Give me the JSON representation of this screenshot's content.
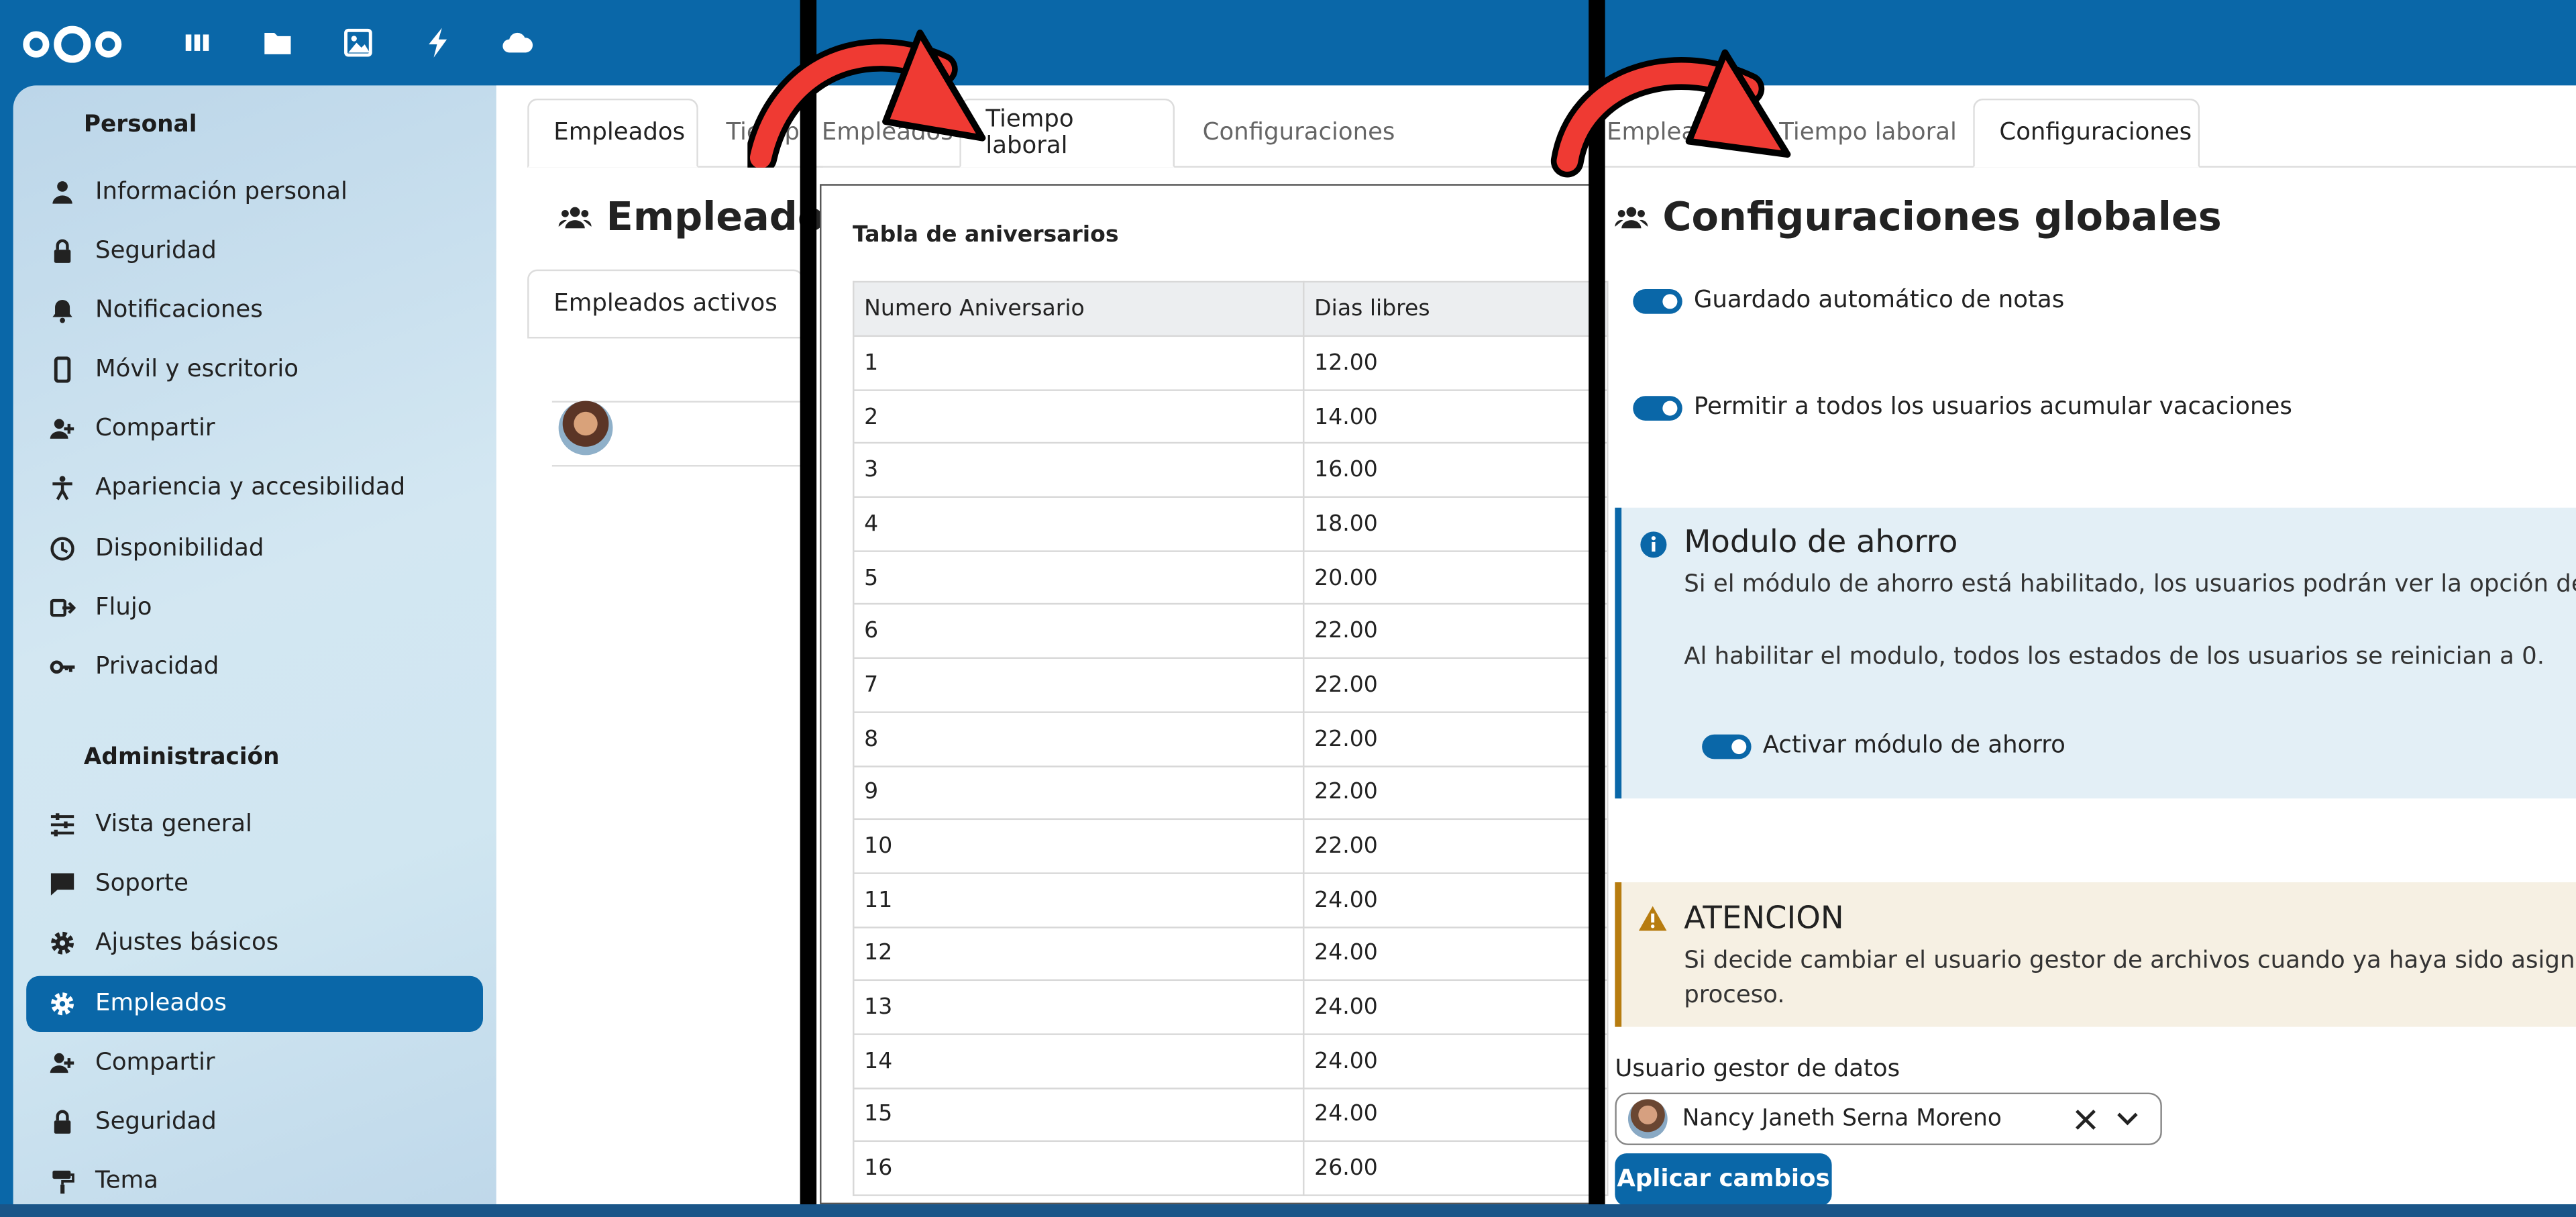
{
  "apps": [
    "dashboard-icon",
    "files-icon",
    "photos-icon",
    "activity-icon",
    "cloud-icon"
  ],
  "colors": {
    "primary": "#0a67a8",
    "warning": "#b77c10",
    "arrow": "#ef3a33"
  },
  "sidebar": {
    "personal_heading": "Personal",
    "personal_items": [
      {
        "label": "Información personal",
        "icon": "person-icon"
      },
      {
        "label": "Seguridad",
        "icon": "lock-icon"
      },
      {
        "label": "Notificaciones",
        "icon": "bell-icon"
      },
      {
        "label": "Móvil y escritorio",
        "icon": "phone-icon"
      },
      {
        "label": "Compartir",
        "icon": "share-icon"
      },
      {
        "label": "Apariencia y accesibilidad",
        "icon": "accessibility-icon"
      },
      {
        "label": "Disponibilidad",
        "icon": "clock-icon"
      },
      {
        "label": "Flujo",
        "icon": "flow-icon"
      },
      {
        "label": "Privacidad",
        "icon": "key-icon"
      }
    ],
    "admin_heading": "Administración",
    "admin_items": [
      {
        "label": "Vista general",
        "icon": "sliders-icon"
      },
      {
        "label": "Soporte",
        "icon": "chat-icon"
      },
      {
        "label": "Ajustes básicos",
        "icon": "gear-icon"
      },
      {
        "label": "Empleados",
        "icon": "gear-icon",
        "active": true
      },
      {
        "label": "Compartir",
        "icon": "share-icon"
      },
      {
        "label": "Seguridad",
        "icon": "lock-icon"
      },
      {
        "label": "Tema",
        "icon": "paint-icon"
      }
    ]
  },
  "panel1": {
    "tabs": [
      "Empleados",
      "Tiempo Empleados"
    ],
    "title": "Empleados",
    "subtab": "Empleados activos"
  },
  "panel2": {
    "tabs": [
      "Tiempo laboral",
      "Configuraciones"
    ],
    "dialog_title": "Tabla de aniversarios",
    "columns": [
      "Numero Aniversario",
      "Dias libres"
    ],
    "rows": [
      [
        "1",
        "12.00"
      ],
      [
        "2",
        "14.00"
      ],
      [
        "3",
        "16.00"
      ],
      [
        "4",
        "18.00"
      ],
      [
        "5",
        "20.00"
      ],
      [
        "6",
        "22.00"
      ],
      [
        "7",
        "22.00"
      ],
      [
        "8",
        "22.00"
      ],
      [
        "9",
        "22.00"
      ],
      [
        "10",
        "22.00"
      ],
      [
        "11",
        "24.00"
      ],
      [
        "12",
        "24.00"
      ],
      [
        "13",
        "24.00"
      ],
      [
        "14",
        "24.00"
      ],
      [
        "15",
        "24.00"
      ],
      [
        "16",
        "26.00"
      ]
    ]
  },
  "panel3": {
    "tabs": [
      "Empleados",
      "Tiempo laboral",
      "Configuraciones"
    ],
    "title": "Configuraciones globales",
    "toggle_autosave": "Guardado automático de notas",
    "toggle_vacations": "Permitir a todos los usuarios acumular vacaciones",
    "info_title": "Modulo de ahorro",
    "info_text1": "Si el módulo de ahorro está habilitado, los usuarios podrán ver la opción de ahorro e",
    "info_text2": "Al habilitar el modulo, todos los estados de los usuarios se reinician a 0.",
    "toggle_savings": "Activar módulo de ahorro",
    "warn_title": "ATENCION",
    "warn_text1": "Si decide cambiar el usuario gestor de archivos cuando ya haya sido asignado, puede",
    "warn_text2": "proceso.",
    "field_label": "Usuario gestor de datos",
    "selected_user": "Nancy Janeth Serna Moreno",
    "apply_button": "Aplicar cambios"
  }
}
